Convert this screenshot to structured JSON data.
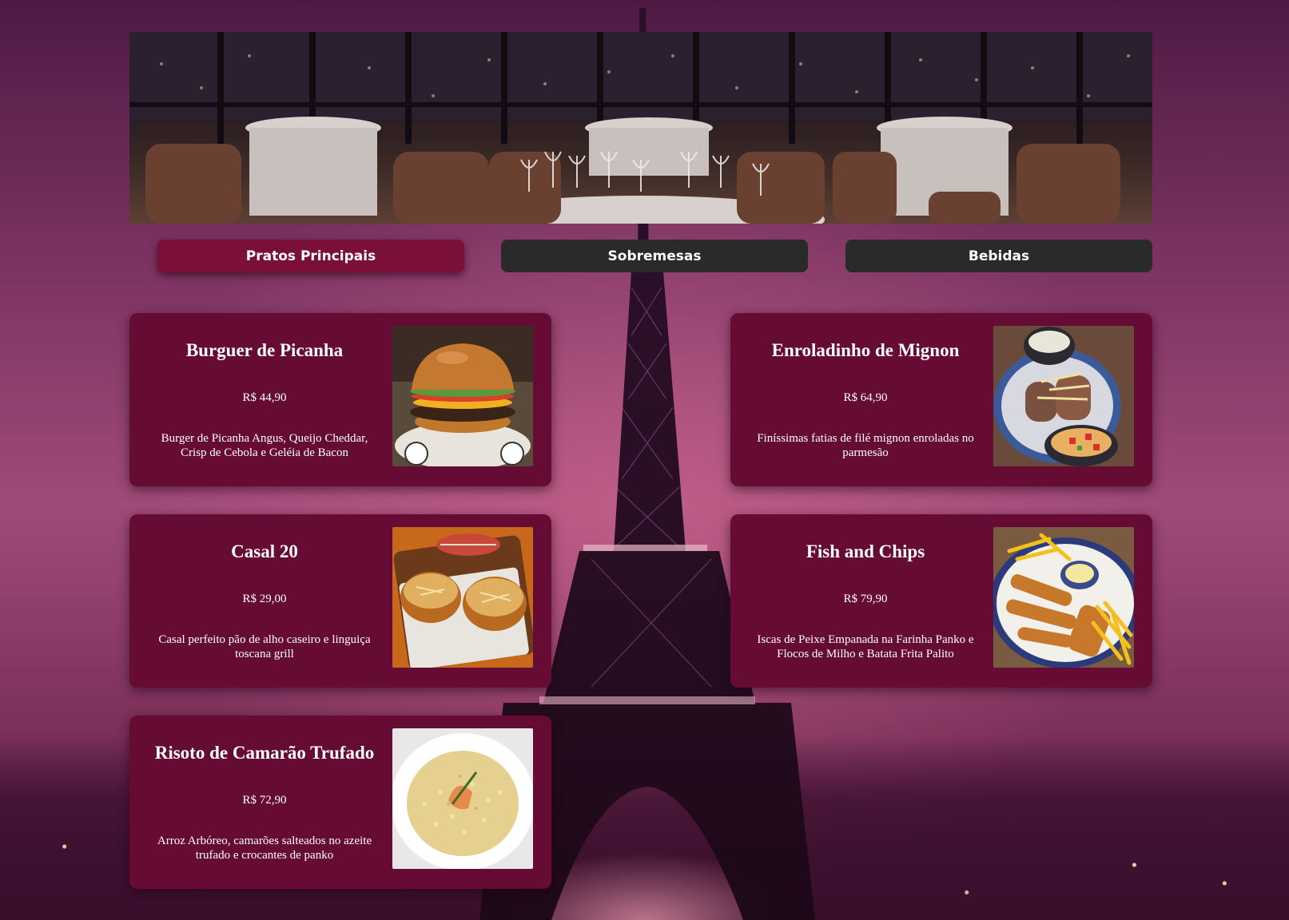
{
  "tabs": [
    {
      "label": "Pratos Principais",
      "active": true
    },
    {
      "label": "Sobremesas",
      "active": false
    },
    {
      "label": "Bebidas",
      "active": false
    }
  ],
  "dishes": [
    {
      "name": "Burguer de Picanha",
      "price": "R$ 44,90",
      "description": "Burger de Picanha Angus, Queijo Cheddar, Crisp de Cebola e Geléia de Bacon",
      "photo_icon": "burger-photo"
    },
    {
      "name": "Enroladinho de Mignon",
      "price": "R$ 64,90",
      "description": "Finíssimas fatias de filé mignon enroladas no parmesão",
      "photo_icon": "mignon-photo"
    },
    {
      "name": "Casal 20",
      "price": "R$ 29,00",
      "description": "Casal perfeito pão de alho caseiro e linguiça toscana grill",
      "photo_icon": "garlic-bread-photo"
    },
    {
      "name": "Fish and Chips",
      "price": "R$ 79,90",
      "description": "Iscas de Peixe Empanada na Farinha Panko e Flocos de Milho e Batata Frita Palito",
      "photo_icon": "fish-chips-photo"
    },
    {
      "name": "Risoto de Camarão Trufado",
      "price": "R$ 72,90",
      "description": "Arroz Arbóreo, camarões salteados no azeite trufado e crocantes de panko",
      "photo_icon": "risotto-photo"
    }
  ],
  "colors": {
    "card": "#660b33",
    "tab_active": "#7a0f3a",
    "tab_inactive": "#2a2a2a",
    "text": "#ffffff"
  }
}
